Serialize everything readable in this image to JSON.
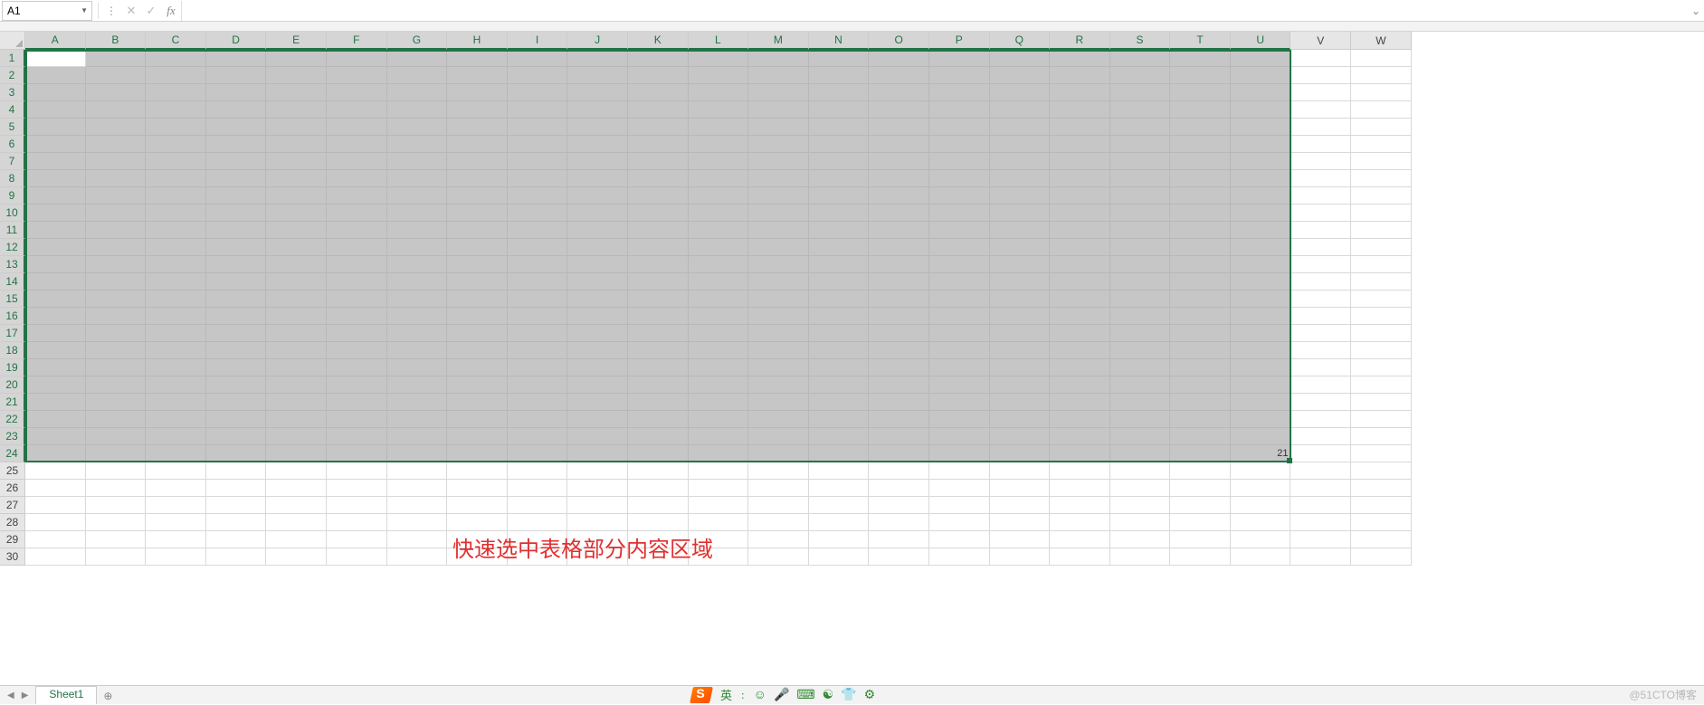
{
  "formula_bar": {
    "name_box": "A1",
    "cancel_btn": "✕",
    "enter_btn": "✓",
    "fx_label": "fx",
    "formula_value": ""
  },
  "columns": [
    "A",
    "B",
    "C",
    "D",
    "E",
    "F",
    "G",
    "H",
    "I",
    "J",
    "K",
    "L",
    "M",
    "N",
    "O",
    "P",
    "Q",
    "R",
    "S",
    "T",
    "U",
    "V",
    "W"
  ],
  "selected_col_count": 21,
  "rows": [
    1,
    2,
    3,
    4,
    5,
    6,
    7,
    8,
    9,
    10,
    11,
    12,
    13,
    14,
    15,
    16,
    17,
    18,
    19,
    20,
    21,
    22,
    23,
    24,
    25,
    26,
    27,
    28,
    29,
    30
  ],
  "selected_row_count": 24,
  "active_cell": "A1",
  "last_cell_value": "21",
  "annotation_text": "快速选中表格部分内容区域",
  "sheet_tab": {
    "name": "Sheet1",
    "add_label": "⊕"
  },
  "taskbar": {
    "text_fragment": "英",
    "icons": [
      "☺",
      "🎤",
      "⌨",
      "☯",
      "👕",
      "⚙"
    ]
  },
  "watermark": "@51CTO博客"
}
